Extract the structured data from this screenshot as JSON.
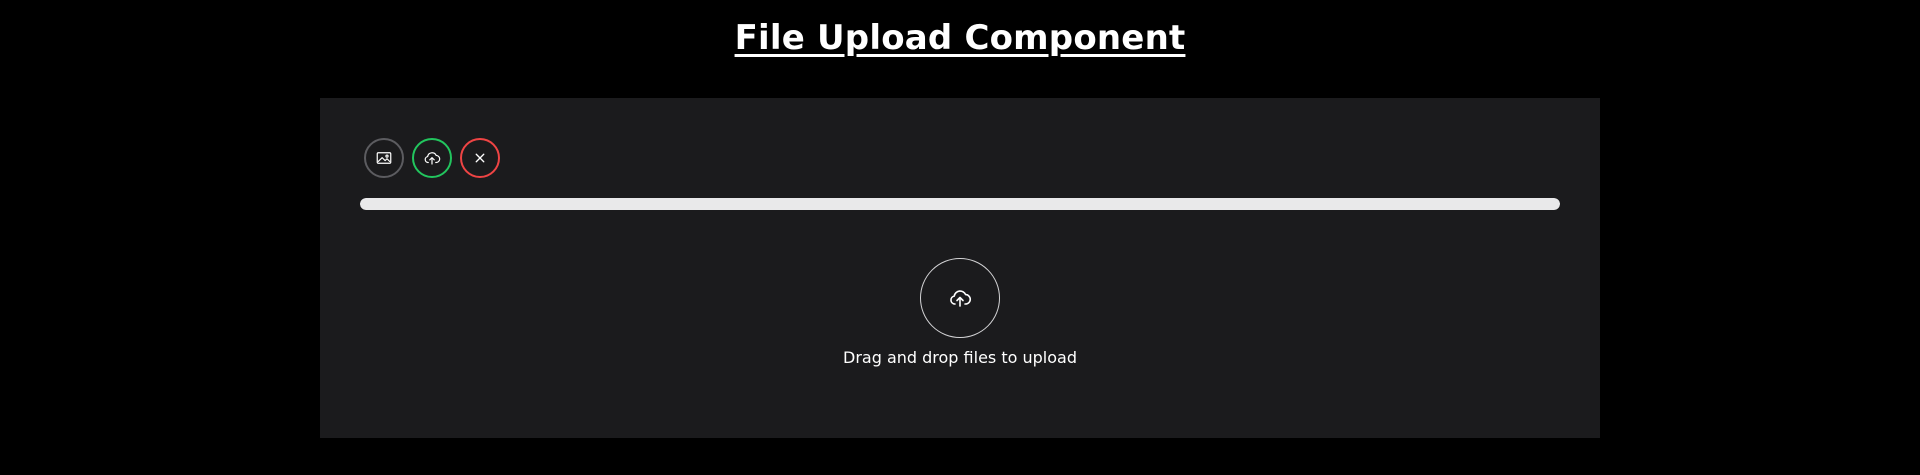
{
  "page": {
    "title": "File Upload Component"
  },
  "toolbar": {
    "buttons": [
      {
        "name": "choose-image",
        "icon": "image-icon",
        "border_color": "#5c5c60"
      },
      {
        "name": "upload",
        "icon": "cloud-upload-icon",
        "border_color": "#22c55e"
      },
      {
        "name": "cancel",
        "icon": "close-icon",
        "border_color": "#ef4444"
      }
    ]
  },
  "progress": {
    "value_percent": 100
  },
  "dropzone": {
    "icon": "cloud-upload-icon",
    "message": "Drag and drop files to upload"
  },
  "colors": {
    "background": "#000000",
    "panel": "#1b1b1d",
    "progress_fill": "#e9e9ea",
    "accent_success": "#22c55e",
    "accent_danger": "#ef4444"
  }
}
